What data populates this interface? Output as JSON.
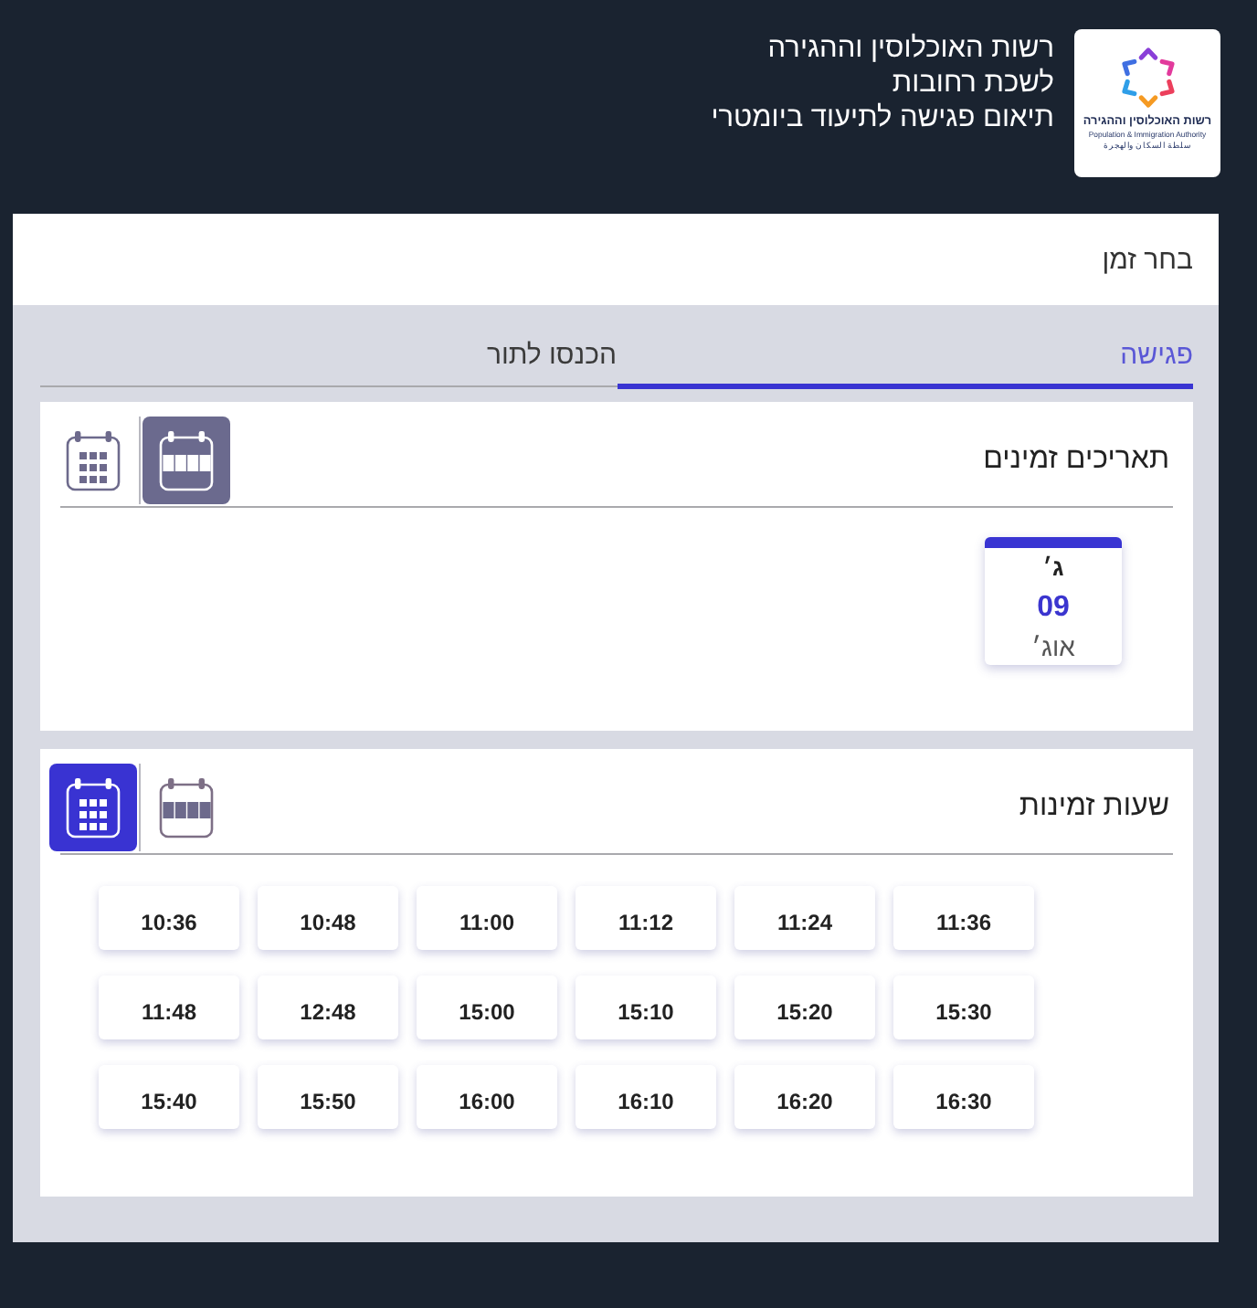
{
  "header": {
    "logo": {
      "name_he": "רשות האוכלוסין וההגירה",
      "name_en": "Population & Immigration Authority",
      "name_ar": "سلطة السكان والهجرة"
    },
    "lines": [
      "רשות האוכלוסין וההגירה",
      "לשכת רחובות",
      "תיאום פגישה לתיעוד ביומטרי"
    ]
  },
  "page": {
    "title": "בחר זמן"
  },
  "tabs": [
    {
      "label": "פגישה",
      "selected": true
    },
    {
      "label": "הכנסו לתור",
      "selected": false
    }
  ],
  "sections": [
    {
      "kind": "dates",
      "title": "תאריכים זמינים",
      "focused": false,
      "views": [
        {
          "kind": "strip",
          "selected": true
        },
        {
          "kind": "grid",
          "selected": false
        }
      ],
      "dates": [
        {
          "weekday": "ג׳",
          "day": "09",
          "month": "אוג׳"
        }
      ]
    },
    {
      "kind": "times",
      "title": "שעות זמינות",
      "focused": true,
      "views": [
        {
          "kind": "strip",
          "selected": false
        },
        {
          "kind": "grid",
          "selected": true
        }
      ],
      "slots": [
        "11:36",
        "11:24",
        "11:12",
        "11:00",
        "10:48",
        "10:36",
        "15:30",
        "15:20",
        "15:10",
        "15:00",
        "12:48",
        "11:48",
        "16:30",
        "16:20",
        "16:10",
        "16:00",
        "15:50",
        "15:40"
      ]
    }
  ]
}
